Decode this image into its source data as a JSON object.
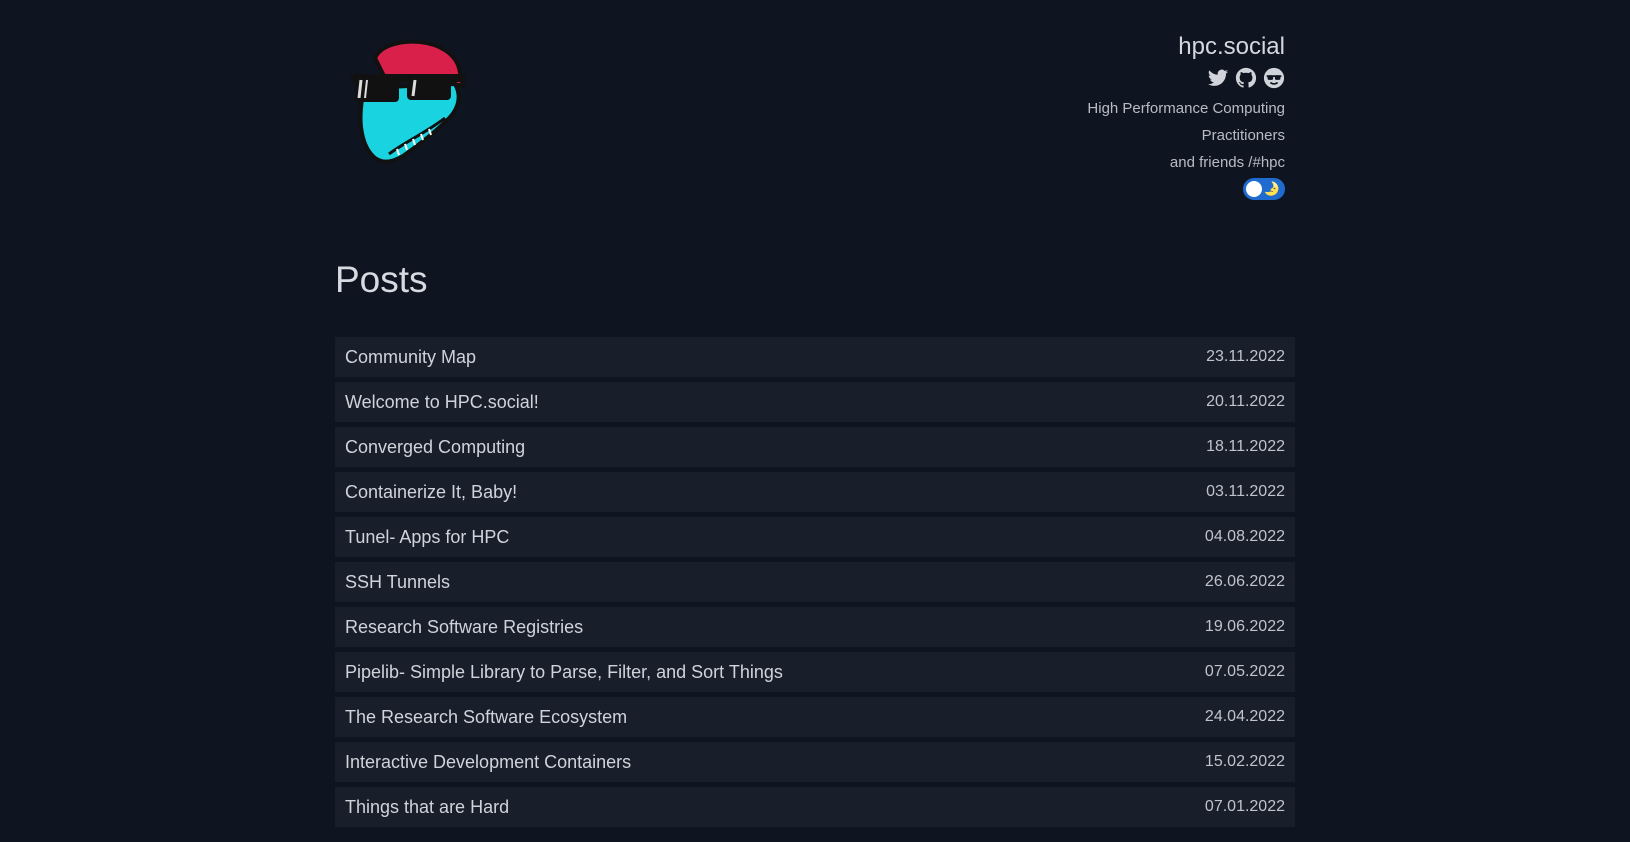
{
  "site": {
    "title": "hpc.social",
    "tagline_lines": [
      "High Performance Computing",
      "Practitioners",
      "and friends /#hpc"
    ],
    "social_icons": [
      "twitter-icon",
      "github-icon",
      "mastodon-icon"
    ],
    "theme_toggle_icon": "🌛"
  },
  "posts": {
    "heading": "Posts",
    "items": [
      {
        "title": "Community Map",
        "date": "23.11.2022"
      },
      {
        "title": "Welcome to HPC.social!",
        "date": "20.11.2022"
      },
      {
        "title": "Converged Computing",
        "date": "18.11.2022"
      },
      {
        "title": "Containerize It, Baby!",
        "date": "03.11.2022"
      },
      {
        "title": "Tunel- Apps for HPC",
        "date": "04.08.2022"
      },
      {
        "title": "SSH Tunnels",
        "date": "26.06.2022"
      },
      {
        "title": "Research Software Registries",
        "date": "19.06.2022"
      },
      {
        "title": "Pipelib- Simple Library to Parse, Filter, and Sort Things",
        "date": "07.05.2022"
      },
      {
        "title": "The Research Software Ecosystem",
        "date": "24.04.2022"
      },
      {
        "title": "Interactive Development Containers",
        "date": "15.02.2022"
      },
      {
        "title": "Things that are Hard",
        "date": "07.01.2022"
      }
    ]
  },
  "colors": {
    "background": "#0f1520",
    "row_background": "#181e2a",
    "toggle": "#1f6bd0"
  }
}
